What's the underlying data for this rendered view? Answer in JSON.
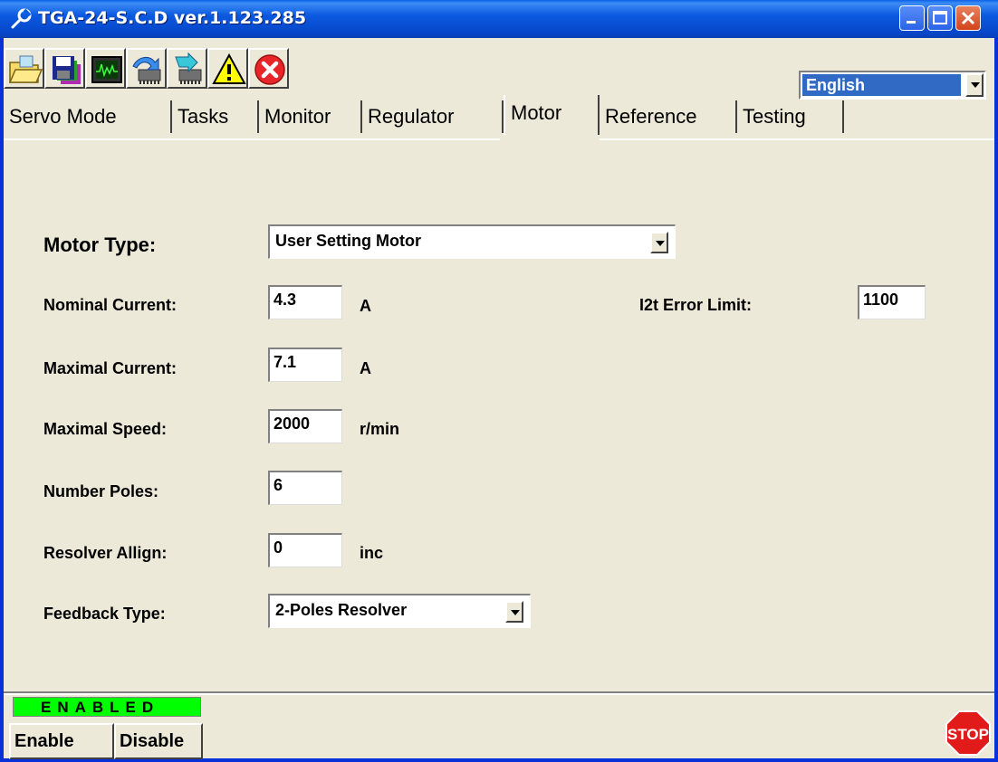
{
  "window": {
    "title": "TGA-24-S.C.D  ver.1.123.285"
  },
  "toolbar": {
    "buttons": [
      {
        "name": "open-folder"
      },
      {
        "name": "save"
      },
      {
        "name": "oscilloscope"
      },
      {
        "name": "download"
      },
      {
        "name": "upload"
      },
      {
        "name": "warning"
      },
      {
        "name": "error"
      }
    ],
    "language": "English"
  },
  "tabs": [
    "Servo Mode",
    "Tasks",
    "Monitor",
    "Regulator",
    "Motor",
    "Reference",
    "Testing"
  ],
  "active_tab": "Motor",
  "motor": {
    "motor_type_label": "Motor Type:",
    "motor_type_value": "User Setting Motor",
    "nominal_current_label": "Nominal Current:",
    "nominal_current_value": "4.3",
    "nominal_current_unit": "A",
    "maximal_current_label": "Maximal Current:",
    "maximal_current_value": "7.1",
    "maximal_current_unit": "A",
    "maximal_speed_label": "Maximal Speed:",
    "maximal_speed_value": "2000",
    "maximal_speed_unit": "r/min",
    "number_poles_label": "Number Poles:",
    "number_poles_value": "6",
    "resolver_align_label": "Resolver Allign:",
    "resolver_align_value": "0",
    "resolver_align_unit": "inc",
    "feedback_type_label": "Feedback Type:",
    "feedback_type_value": "2-Poles Resolver",
    "i2t_label": "I2t Error Limit:",
    "i2t_value": "1100"
  },
  "status": {
    "text": "ENABLED",
    "color": "#00ff00"
  },
  "buttons": {
    "enable": "Enable",
    "disable": "Disable",
    "stop": "STOP"
  }
}
